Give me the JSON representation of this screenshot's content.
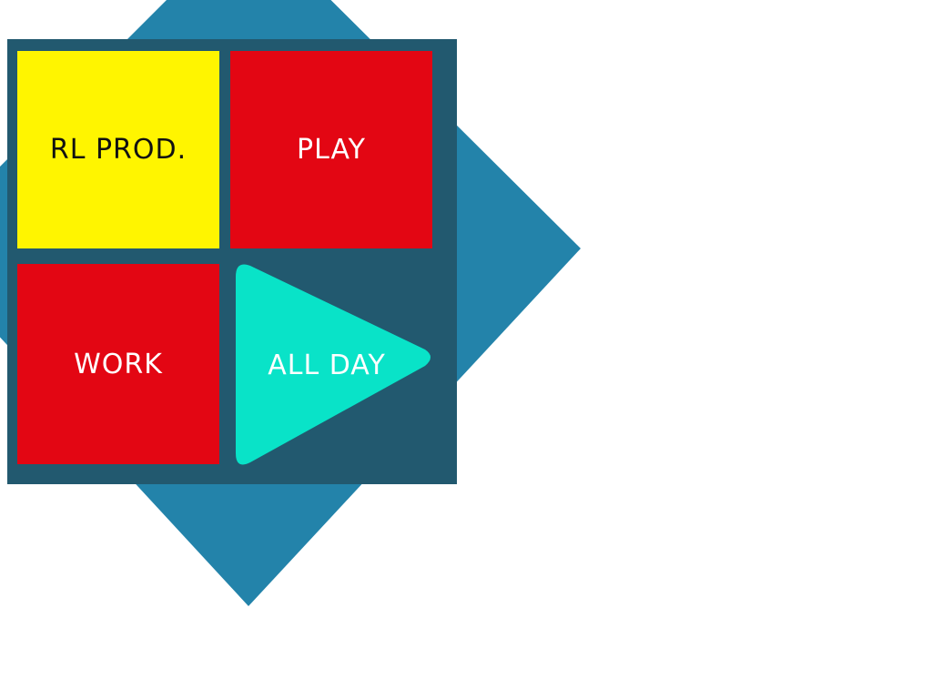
{
  "colors": {
    "diamond": "#2383aa",
    "panel": "#22596f",
    "logo_tile": "#fff500",
    "action_tile": "#e30613",
    "play_triangle": "#09e3c8",
    "dark_text": "#111111",
    "light_text": "#ffffff"
  },
  "tiles": {
    "logo": {
      "label": "RL PROD."
    },
    "play": {
      "label": "PLAY"
    },
    "work": {
      "label": "WORK"
    },
    "all_day": {
      "label": "ALL DAY",
      "icon": "play-triangle-icon"
    }
  }
}
